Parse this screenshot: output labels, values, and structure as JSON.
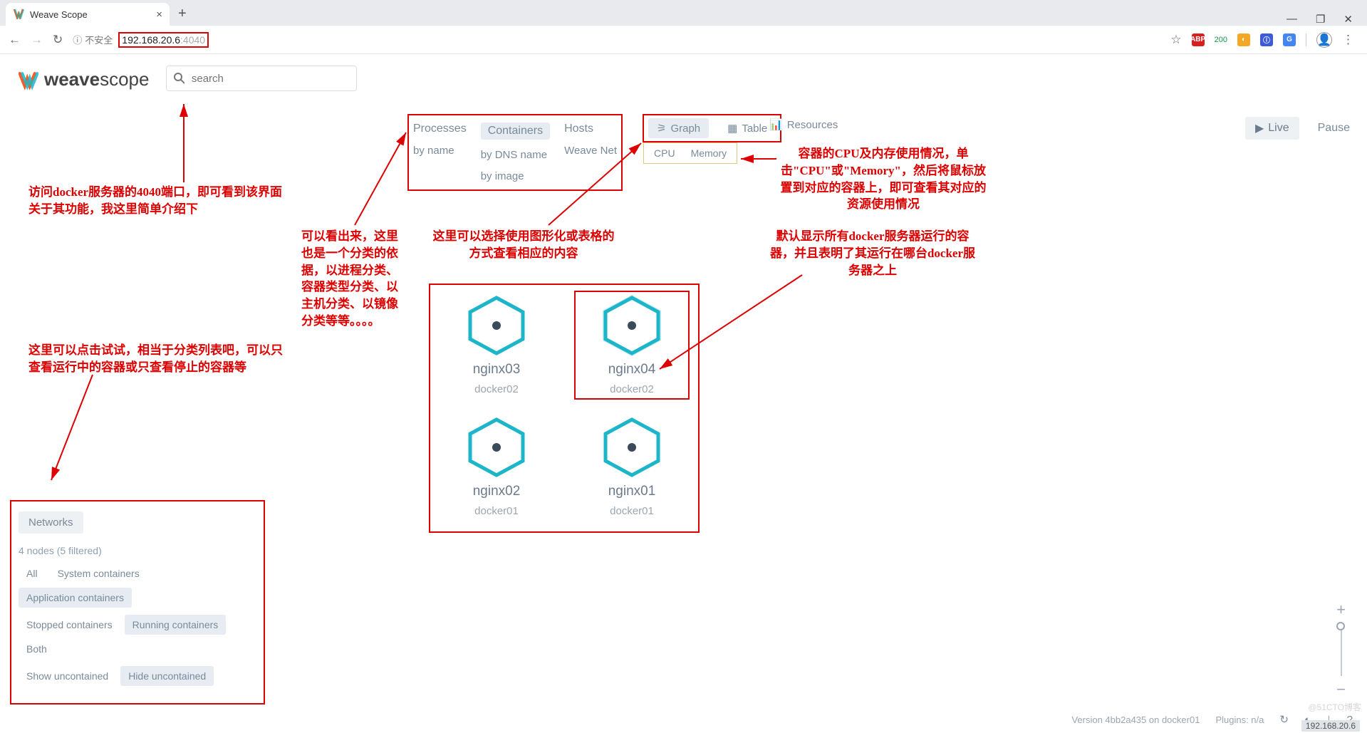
{
  "browser": {
    "tab_title": "Weave Scope",
    "tab_close": "×",
    "new_tab": "+",
    "win_min": "—",
    "win_max": "❐",
    "win_close": "✕",
    "nav_back": "←",
    "nav_fwd": "→",
    "reload": "↻",
    "info_icon": "ⓘ",
    "insecure": "不安全",
    "url_host": "192.168.20.6",
    "url_port": ":4040",
    "star": "☆",
    "ext_abp": "ABP",
    "ext_200": "200",
    "menu": "⋮"
  },
  "app": {
    "logo_bold": "weave",
    "logo_light": "scope",
    "search_placeholder": "search",
    "search_icon": "search"
  },
  "topology": {
    "proc_head": "Processes",
    "proc_sub1": "by name",
    "cont_head": "Containers",
    "cont_sub1": "by DNS name",
    "cont_sub2": "by image",
    "host_head": "Hosts",
    "host_sub1": "Weave Net"
  },
  "viewmode": {
    "graph": "Graph",
    "table": "Table",
    "resources": "Resources"
  },
  "metrics": {
    "cpu": "CPU",
    "memory": "Memory"
  },
  "live": {
    "live": "Live",
    "pause": "Pause",
    "play": "▶"
  },
  "annotations": {
    "url": "访问docker服务器的4040端口，即可看到该界面关于其功能，我这里简单介绍下",
    "topo": "可以看出来，这里也是一个分类的依据，以进程分类、容器类型分类、以主机分类、以镜像分类等等。。。。",
    "view": "这里可以选择使用图形化或表格的方式查看相应的内容",
    "metrics": "容器的CPU及内存使用情况，单击\"CPU\"或\"Memory\"，然后将鼠标放置到对应的容器上，即可查看其对应的资源使用情况",
    "nodes": "默认显示所有docker服务器运行的容器，并且表明了其运行在哪台docker服务器之上",
    "filters": "这里可以点击试试，相当于分类列表吧，可以只查看运行中的容器或只查看停止的容器等"
  },
  "nodes": [
    {
      "name": "nginx03",
      "host": "docker02",
      "sel": false
    },
    {
      "name": "nginx04",
      "host": "docker02",
      "sel": true
    },
    {
      "name": "nginx02",
      "host": "docker01",
      "sel": false
    },
    {
      "name": "nginx01",
      "host": "docker01",
      "sel": false
    }
  ],
  "panel": {
    "title": "Networks",
    "info": "4 nodes (5 filtered)",
    "f_all": "All",
    "f_sys": "System containers",
    "f_app": "Application containers",
    "f_stopped": "Stopped containers",
    "f_running": "Running containers",
    "f_both": "Both",
    "f_show": "Show uncontained",
    "f_hide": "Hide uncontained"
  },
  "footer": {
    "version": "Version 4bb2a435 on docker01",
    "plugins": "Plugins: n/a"
  },
  "watermark": "@51CTO博客",
  "ip_wm": "192.168.20.6"
}
